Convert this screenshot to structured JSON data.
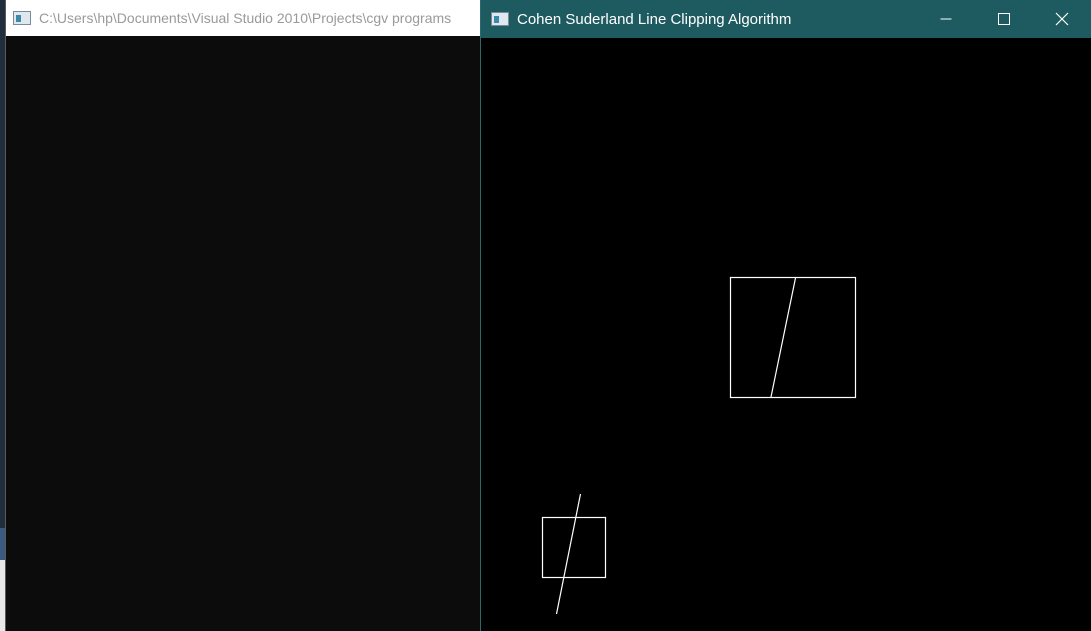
{
  "console": {
    "title": "C:\\Users\\hp\\Documents\\Visual Studio 2010\\Projects\\cgv programs"
  },
  "glut": {
    "title": "Cohen Suderland Line Clipping Algorithm"
  },
  "caption_icons": {
    "minimize": "minimize-icon",
    "maximize": "maximize-icon",
    "close": "close-icon"
  },
  "colors": {
    "glut_titlebar": "#1e5b60",
    "console_background": "#0c0c0c",
    "drawing_stroke": "#ffffff"
  }
}
